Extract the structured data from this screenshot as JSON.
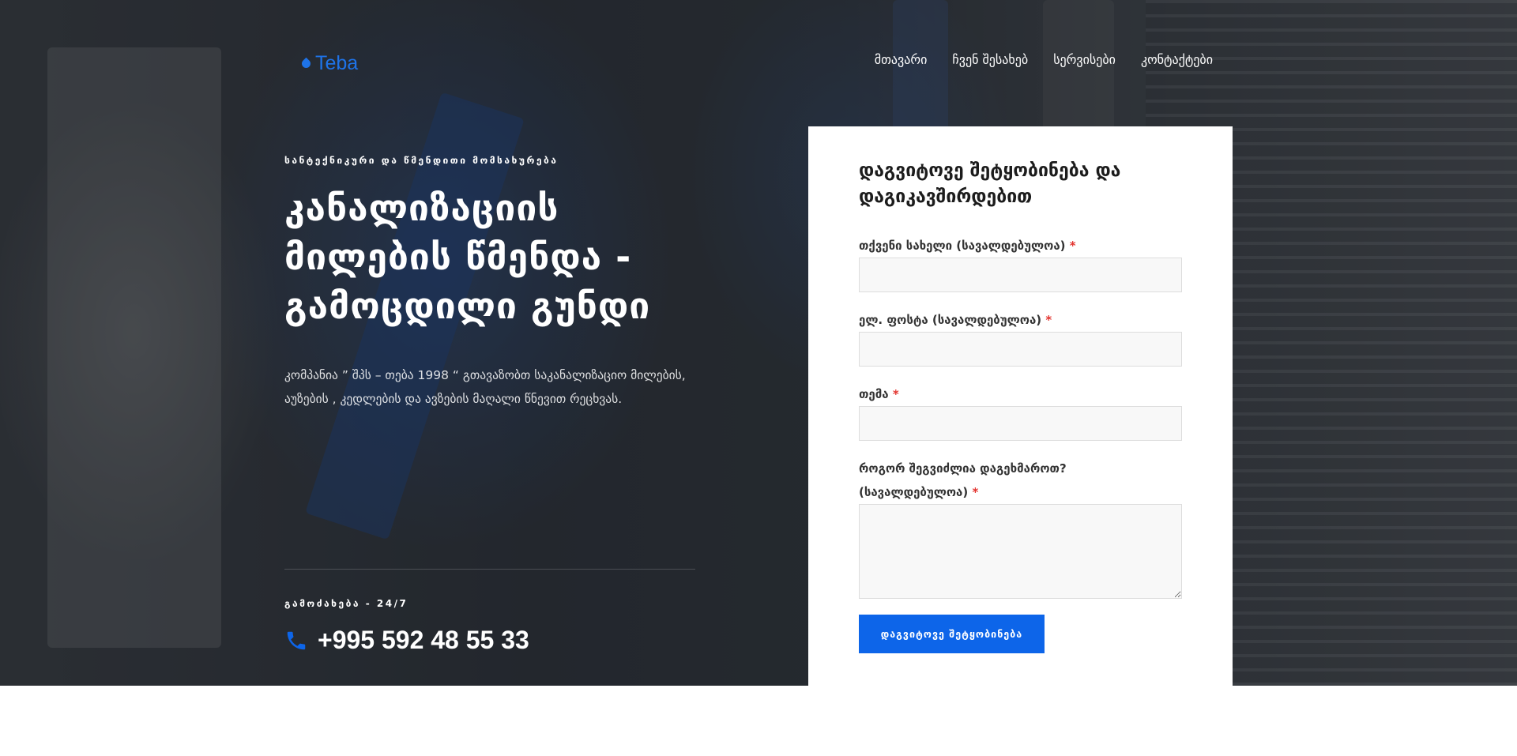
{
  "header": {
    "logo_text": "Teba",
    "logo_icon": "water-drop-icon",
    "nav": [
      {
        "label": "მთავარი"
      },
      {
        "label": "ჩვენ შესახებ"
      },
      {
        "label": "სერვისები"
      },
      {
        "label": "კონტაქტები"
      }
    ]
  },
  "hero": {
    "eyebrow": "სანტექნიკური და წმენდითი მომსახურება",
    "title_lines": [
      "კანალიზაციის",
      "მილების წმენდა -",
      "გამოცდილი გუნდი"
    ],
    "description_lines": [
      "კომპანია ” შპს – თება 1998 “ გთავაზობთ საკანალიზაციო მილების,",
      "აუზების , კედლების და ავზების მაღალი წნევით რეცხვას."
    ],
    "availability": "გამოძახება - 24/7",
    "phone": "+995 592 48 55 33",
    "phone_icon": "phone-icon"
  },
  "form": {
    "title": "დაგვიტოვე შეტყობინება და დაგიკავშირდებით",
    "fields": [
      {
        "label": "თქვენი სახელი (სავალდებულოა)",
        "required_mark": "*",
        "value": ""
      },
      {
        "label": "ელ. ფოსტა (სავალდებულოა)",
        "required_mark": "*",
        "value": ""
      },
      {
        "label": "თემა",
        "required_mark": "*",
        "value": ""
      }
    ],
    "message_label_line1": "როგორ შეგვიძლია დაგეხმაროთ?",
    "message_label_line2": "(სავალდებულოა)",
    "message_required_mark": "*",
    "message_value": "",
    "submit_label": "დაგვიტოვე შეტყობინება"
  },
  "colors": {
    "accent": "#0d65e9",
    "logo": "#1e73e8",
    "required": "#e3342f"
  }
}
